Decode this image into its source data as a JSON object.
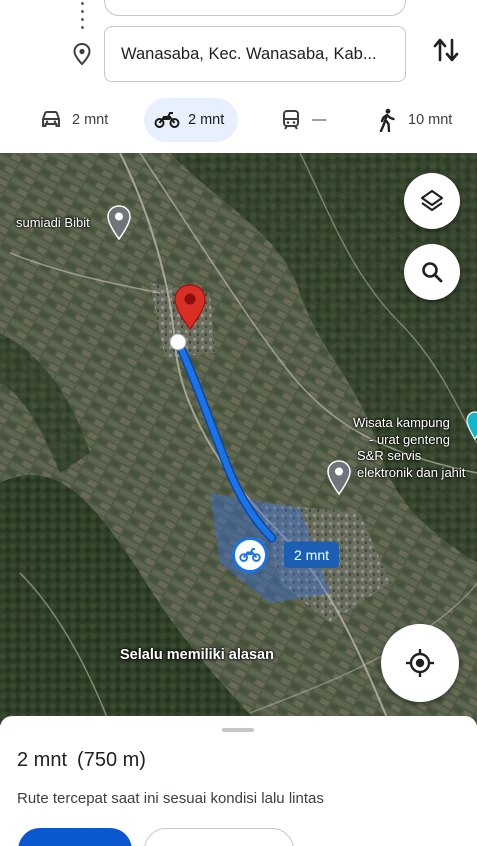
{
  "search": {
    "destination": "Wanasaba, Kec. Wanasaba, Kab...",
    "origin": ""
  },
  "modes": [
    {
      "icon": "car-icon",
      "label": "2 mnt"
    },
    {
      "icon": "motorcycle-icon",
      "label": "2 mnt"
    },
    {
      "icon": "transit-icon",
      "label": "—"
    },
    {
      "icon": "walk-icon",
      "label": "10 mnt"
    }
  ],
  "map": {
    "places": {
      "sumiadi": "sumiadi Bibit",
      "wisata_line1": "Wisata kampung",
      "wisata_line2": "- urat genteng",
      "servis_line1": "S&R servis",
      "servis_line2": "elektronik dan jahit"
    },
    "route_label": "2 mnt",
    "caption": "Selalu memiliki alasan",
    "route_color": "#1a73e8"
  },
  "sheet": {
    "duration": "2 mnt",
    "distance": "(750 m)",
    "description": "Rute tercepat saat ini sesuai kondisi lalu lintas"
  },
  "colors": {
    "accent": "#1a73e8",
    "pin": "#d93025",
    "active_mode_bg": "#e8f0fe"
  }
}
